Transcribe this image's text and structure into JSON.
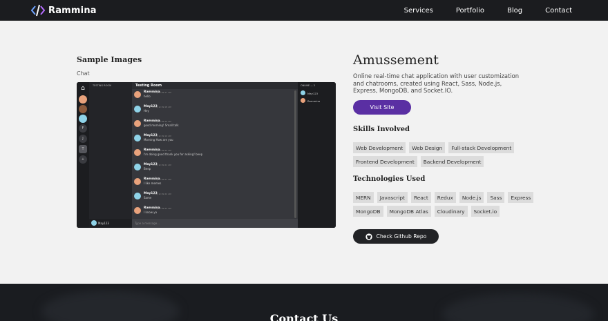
{
  "brand": {
    "name": "Rammina",
    "logo_icon": "code-slash-icon"
  },
  "nav": {
    "links": [
      "Services",
      "Portfolio",
      "Blog",
      "Contact"
    ]
  },
  "left": {
    "section_title": "Sample Images",
    "image_label": "Chat"
  },
  "chat_screenshot": {
    "rooms_title": "TESTING ROOM",
    "room_title": "Testing Room",
    "rail_items": [
      "F",
      "J",
      "T",
      "+"
    ],
    "user_name": "May123",
    "input_placeholder": "Type a message...",
    "online_title": "ONLINE — 2",
    "online_users": [
      "May123",
      "Rammina"
    ],
    "messages": [
      {
        "user": "Rammina",
        "time": "Today at 09:17 AM",
        "text": "hello",
        "color": "#e8a27c"
      },
      {
        "user": "May123",
        "time": "Today at 09:18 AM",
        "text": "Hey",
        "color": "#8fd3e8"
      },
      {
        "user": "Rammina",
        "time": "Today at 09:19 AM",
        "text": "good morning! Small talk",
        "color": "#e8a27c"
      },
      {
        "user": "May123",
        "time": "Today at 09:19 AM",
        "text": "Morning How are you",
        "color": "#8fd3e8"
      },
      {
        "user": "Rammina",
        "time": "Today at 09:20 AM",
        "text": "I'm doing good thank you for asking! beep",
        "color": "#e8a27c"
      },
      {
        "user": "May123",
        "time": "Today at 09:21 AM",
        "text": "Beep",
        "color": "#8fd3e8"
      },
      {
        "user": "Rammina",
        "time": "Today at 09:21 AM",
        "text": "I like memes",
        "color": "#e8a27c"
      },
      {
        "user": "May123",
        "time": "Today at 09:22 AM",
        "text": "Same",
        "color": "#8fd3e8"
      },
      {
        "user": "Rammina",
        "time": "Today at 09:23 AM",
        "text": "I know ya",
        "color": "#e8a27c"
      }
    ]
  },
  "project": {
    "title": "Amussement",
    "description": "Online real-time chat application with user customization and chatrooms, created using React, Sass, Node.js, Express, MongoDB, and Socket.IO.",
    "visit_label": "Visit Site",
    "skills_title": "Skills Involved",
    "skills": [
      "Web Development",
      "Web Design",
      "Full-stack Development",
      "Frontend Development",
      "Backend Development"
    ],
    "tech_title": "Technologies Used",
    "technologies": [
      "MERN",
      "Javascript",
      "React",
      "Redux",
      "Node.js",
      "Sass",
      "Express",
      "MongoDB",
      "MongoDB Atlas",
      "Cloudinary",
      "Socket.io"
    ],
    "github_label": "Check Github Repo",
    "github_icon": "github-icon"
  },
  "footer": {
    "title": "Contact Us"
  },
  "colors": {
    "nav_bg": "#1b1c1f",
    "accent": "#5a2fa3",
    "page_bg": "#f2f2f2"
  }
}
